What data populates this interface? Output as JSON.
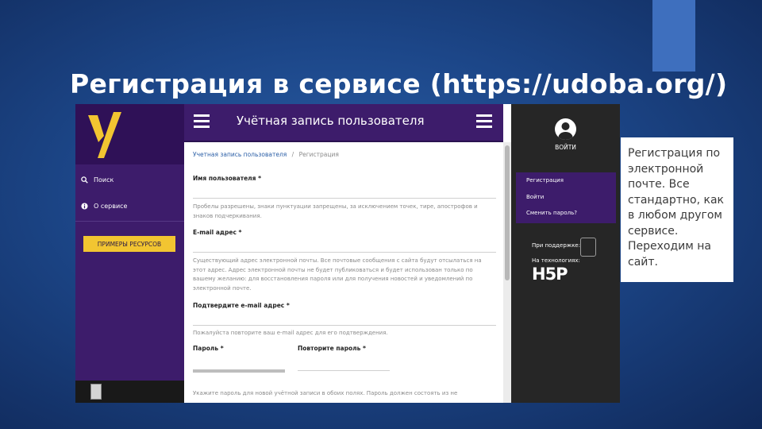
{
  "slide": {
    "title": "Регистрация в сервисе (https://udoba.org/)",
    "callout_text": "Регистрация по электронной почте. Все стандартно, как в любом другом сервисе. Переходим на сайт."
  },
  "left_sidebar": {
    "menu": [
      {
        "label": "Поиск",
        "icon": "search-icon"
      },
      {
        "label": "О сервисе",
        "icon": "info-icon"
      }
    ],
    "resources_button": "ПРИМЕРЫ РЕСУРСОВ"
  },
  "header": {
    "title": "Учётная запись пользователя"
  },
  "breadcrumb": {
    "link": "Учетная запись пользователя",
    "separator": "/",
    "current": "Регистрация"
  },
  "form": {
    "username_label": "Имя пользователя *",
    "username_help": "Пробелы разрешены, знаки пунктуации запрещены, за исключением точек, тире, апострофов и знаков подчеркивания.",
    "email_label": "E-mail адрес *",
    "email_help": "Существующий адрес электронной почты. Все почтовые сообщения с сайта будут отсылаться на этот адрес. Адрес электронной почты не будет публиковаться и будет использован только по вашему желанию: для восстановления пароля или для получения новостей и уведомлений по электронной почте.",
    "confirm_email_label": "Подтвердите e-mail адрес *",
    "confirm_email_help": "Пожалуйста повторите ваш e-mail адрес для его подтверждения.",
    "password_label": "Пароль *",
    "repeat_password_label": "Повторите пароль *",
    "password_help": "Укажите пароль для новой учётной записи в обоих полях. Пароль должен состоять из не"
  },
  "right_sidebar": {
    "login_label": "ВОЙТИ",
    "auth_menu": [
      "Регистрация",
      "Войти",
      "Сменить пароль?"
    ],
    "support_label": "При поддержке:",
    "tech_label": "На технологиях:",
    "tech_logo": "H5P"
  },
  "colors": {
    "purple": "#3d1c6b",
    "yellow": "#f2c531",
    "dark": "#262626",
    "slide_bg": "#1c4688"
  }
}
